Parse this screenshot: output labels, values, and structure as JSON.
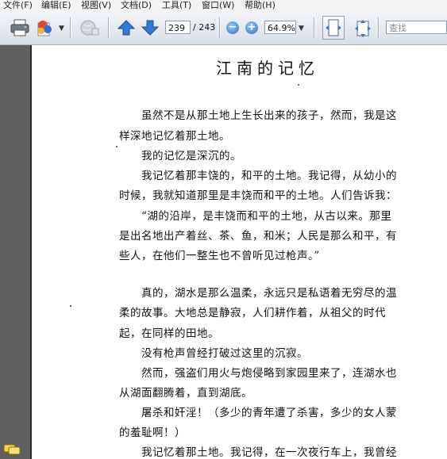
{
  "menu": [
    "文件(F)",
    "编辑(E)",
    "视图(V)",
    "文档(D)",
    "工具(T)",
    "窗口(W)",
    "帮助(H)"
  ],
  "toolbar": {
    "current_page": "239",
    "total_pages": "/ 243",
    "zoom": "64.9%",
    "search_placeholder": "查找",
    "icons": [
      "printer-icon",
      "export-icon",
      "globe-icon",
      "prev-page-icon",
      "next-page-icon",
      "zoom-out-icon",
      "zoom-in-icon",
      "fit-width-icon",
      "fit-page-icon"
    ]
  },
  "document": {
    "title": "江南的记忆",
    "lines": [
      "虽然不是从那土地上生长出来的孩子，然而，我是这",
      "样深地记忆着那土地。",
      "我的记忆是深沉的。",
      "我记忆着那丰饶的，和平的土地。我记得，从幼小的",
      "时候，我就知道那里是丰饶而和平的土地。人们告诉我：",
      "“湖的沿岸，是丰饶而和平的土地，从古以来。那里",
      "是出名地出产着丝、茶、鱼，和米；人民是那么和平，有",
      "些人，在他们一整生也不曾听见过枪声。”",
      "真的，湖水是那么温柔，永远只是私语着无穷尽的温",
      "柔的故事。大地总是静寂，人们耕作着，从祖父的时代",
      "起，在同样的田地。",
      "没有枪声曾经打破过这里的沉寂。",
      "然而，强盗们用火与炮侵略到家园里来了，连湖水也",
      "从湖面翻腾着，直到湖底。",
      "屠杀和奸淫！（多少的青年遭了杀害，多少的女人蒙",
      "的羞耻啊！）",
      "我记忆着那土地。我记得，在一次夜行车上，我曾经"
    ]
  }
}
